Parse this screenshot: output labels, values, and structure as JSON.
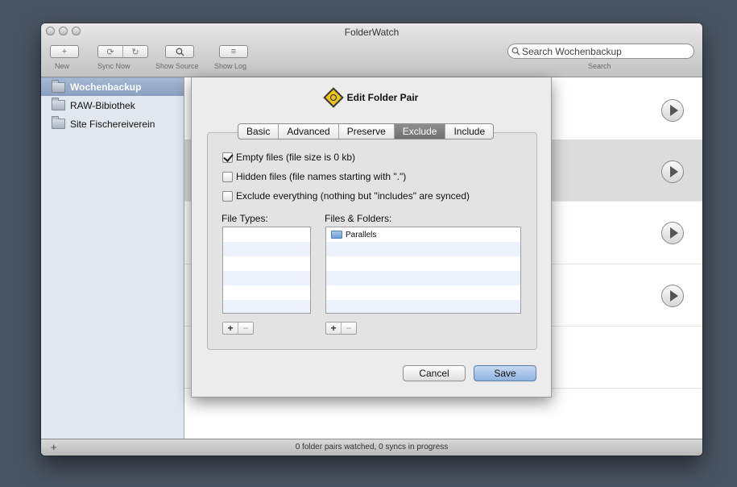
{
  "window": {
    "title": "FolderWatch"
  },
  "toolbar": {
    "new_label": "New",
    "sync_now_label": "Sync Now",
    "show_source_label": "Show Source",
    "show_log_label": "Show Log"
  },
  "search": {
    "value": "Search Wochenbackup",
    "label": "Search"
  },
  "sidebar": {
    "items": [
      {
        "label": "Wochenbackup"
      },
      {
        "label": "RAW-Bibiothek"
      },
      {
        "label": "Site Fischereiverein"
      }
    ]
  },
  "statusbar": {
    "text": "0 folder pairs watched, 0 syncs in progress"
  },
  "sheet": {
    "title": "Edit Folder Pair",
    "tabs": [
      "Basic",
      "Advanced",
      "Preserve",
      "Exclude",
      "Include"
    ],
    "active_tab": "Exclude",
    "checkboxes": [
      {
        "label": "Empty files (file size is 0 kb)",
        "checked": true
      },
      {
        "label": "Hidden files (file names starting with \".\")",
        "checked": false
      },
      {
        "label": "Exclude everything (nothing but \"includes\" are synced)",
        "checked": false
      }
    ],
    "file_types_label": "File Types:",
    "files_folders_label": "Files & Folders:",
    "files_folders": [
      "Parallels"
    ],
    "cancel_label": "Cancel",
    "save_label": "Save"
  },
  "colors": {
    "desktop": "#4a5563",
    "sidebar_selected": "#97abc9",
    "active_tab": "#7f7f7f",
    "default_button": "#a9c5e8"
  }
}
